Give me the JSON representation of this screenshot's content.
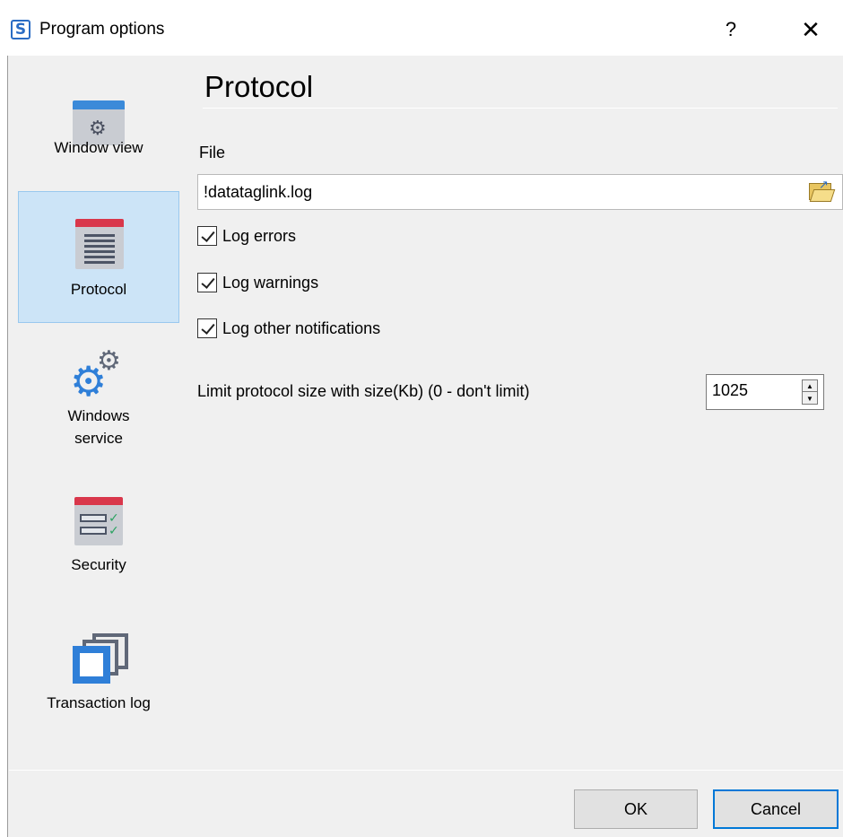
{
  "window": {
    "title": "Program options",
    "help_label": "?",
    "close_label": "✕",
    "app_icon_glyph": "S"
  },
  "sidebar": {
    "items": [
      {
        "label": "Window view",
        "icon": "window-gear-icon",
        "selected": false
      },
      {
        "label": "Protocol",
        "icon": "document-list-icon",
        "selected": true
      },
      {
        "label": "Windows service",
        "icon": "gears-icon",
        "selected": false
      },
      {
        "label": "Security",
        "icon": "checklist-icon",
        "selected": false
      },
      {
        "label": "Transaction log",
        "icon": "stacked-windows-icon",
        "selected": false
      }
    ]
  },
  "content": {
    "title": "Protocol",
    "file_label": "File",
    "file_value": "!datataglink.log",
    "checkboxes": [
      {
        "label": "Log errors",
        "checked": true
      },
      {
        "label": "Log warnings",
        "checked": true
      },
      {
        "label": "Log other notifications",
        "checked": true
      }
    ],
    "limit_label": "Limit protocol size with size(Kb) (0 - don't limit)",
    "limit_value": "1025"
  },
  "footer": {
    "ok_label": "OK",
    "cancel_label": "Cancel"
  },
  "colors": {
    "selected_bg": "#cce4f7",
    "accent": "#0078d7",
    "icon_blue": "#2f7fd8",
    "icon_red": "#d9374b"
  }
}
